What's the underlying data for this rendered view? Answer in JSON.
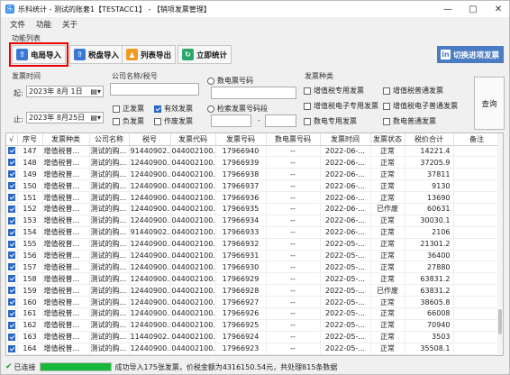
{
  "window": {
    "title": "乐科统计 - 测试的账套1【TESTACC1】 - 【销项发票管理】",
    "controls": [
      "minimize",
      "maximize",
      "close"
    ]
  },
  "menu": [
    "文件",
    "功能",
    "关于"
  ],
  "toolbar": {
    "section_label": "功能列表",
    "buttons": [
      {
        "label": "电局导入",
        "icon": "upload-icon",
        "color": "#3a78d6"
      },
      {
        "label": "税盘导入",
        "icon": "upload-icon",
        "color": "#3a78d6"
      },
      {
        "label": "列表导出",
        "icon": "export-icon",
        "color": "#f09a20"
      },
      {
        "label": "立即统计",
        "icon": "refresh-icon",
        "color": "#2aa96a"
      }
    ],
    "switch_label": "切换进项发票",
    "switch_prefix": "in"
  },
  "filters": {
    "time_label": "发票时间",
    "from_label": "起:",
    "from_date": "2023年 8月 1日",
    "to_label": "止:",
    "to_date": "2023年 8月25日",
    "company_label": "公司名称/税号",
    "checkboxes": [
      {
        "label": "正发票",
        "checked": false
      },
      {
        "label": "有效发票",
        "checked": true
      },
      {
        "label": "负发票",
        "checked": false
      },
      {
        "label": "作废发票",
        "checked": false
      }
    ],
    "radio_number": "数电票号码",
    "radio_range": "检索发票号码段",
    "range_sep": "-",
    "type_label": "发票种类",
    "types": [
      {
        "label": "增值税专用发票",
        "checked": false
      },
      {
        "label": "增值税普通发票",
        "checked": false
      },
      {
        "label": "增值税电子专用发票",
        "checked": false
      },
      {
        "label": "增值税电子普通发票",
        "checked": false
      },
      {
        "label": "数电专用发票",
        "checked": false
      },
      {
        "label": "数电普通发票",
        "checked": false
      }
    ],
    "query_label": "查询"
  },
  "table": {
    "columns": [
      "√",
      "序号",
      "发票种类",
      "公司名称",
      "税号",
      "发票代码",
      "发票号码",
      "数电票号码",
      "发票时间",
      "发票状态",
      "税价合计",
      "备注"
    ],
    "rows": [
      [
        "147",
        "增值税普...",
        "测试的购...",
        "91440902...",
        "044002100...",
        "17966940",
        "--",
        "2022-06-...",
        "正常",
        "14221.4",
        ""
      ],
      [
        "148",
        "增值税普...",
        "测试的购...",
        "12440900...",
        "044002100...",
        "17966939",
        "--",
        "2022-06-...",
        "正常",
        "37205.9",
        ""
      ],
      [
        "149",
        "增值税普...",
        "测试的购...",
        "12440900...",
        "044002100...",
        "17966938",
        "--",
        "2022-06-...",
        "正常",
        "37811",
        ""
      ],
      [
        "150",
        "增值税普...",
        "测试的购...",
        "12440900...",
        "044002100...",
        "17966937",
        "--",
        "2022-06-...",
        "正常",
        "9130",
        ""
      ],
      [
        "151",
        "增值税普...",
        "测试的购...",
        "12440900...",
        "044002100...",
        "17966936",
        "--",
        "2022-06-...",
        "正常",
        "13690",
        ""
      ],
      [
        "152",
        "增值税普...",
        "测试的购...",
        "12440900...",
        "044002100...",
        "17966935",
        "--",
        "2022-06-...",
        "已作废",
        "60631",
        ""
      ],
      [
        "153",
        "增值税普...",
        "测试的购...",
        "12440900...",
        "044002100...",
        "17966934",
        "--",
        "2022-06-...",
        "正常",
        "30030.1",
        ""
      ],
      [
        "154",
        "增值税普...",
        "测试的购...",
        "91440902...",
        "044002100...",
        "17966933",
        "--",
        "2022-06-...",
        "正常",
        "2106",
        ""
      ],
      [
        "155",
        "增值税普...",
        "测试的购...",
        "12440900...",
        "044002100...",
        "17966932",
        "--",
        "2022-05-...",
        "正常",
        "21301.2",
        ""
      ],
      [
        "156",
        "增值税普...",
        "测试的购...",
        "12440900...",
        "044002100...",
        "17966931",
        "--",
        "2022-05-...",
        "正常",
        "36400",
        ""
      ],
      [
        "157",
        "增值税普...",
        "测试的购...",
        "12440900...",
        "044002100...",
        "17966930",
        "--",
        "2022-05-...",
        "正常",
        "27880",
        ""
      ],
      [
        "158",
        "增值税普...",
        "测试的购...",
        "12440900...",
        "044002100...",
        "17966929",
        "--",
        "2022-05-...",
        "正常",
        "63831.2",
        ""
      ],
      [
        "159",
        "增值税普...",
        "测试的购...",
        "12440900...",
        "044002100...",
        "17966928",
        "--",
        "2022-05-...",
        "已作废",
        "63831.2",
        ""
      ],
      [
        "160",
        "增值税普...",
        "测试的购...",
        "12440900...",
        "044002100...",
        "17966927",
        "--",
        "2022-05-...",
        "正常",
        "38605.8",
        ""
      ],
      [
        "161",
        "增值税普...",
        "测试的购...",
        "12440900...",
        "044002100...",
        "17966926",
        "--",
        "2022-05-...",
        "正常",
        "66008",
        ""
      ],
      [
        "162",
        "增值税普...",
        "测试的购...",
        "12440900...",
        "044002100...",
        "17966925",
        "--",
        "2022-05-...",
        "正常",
        "70940",
        ""
      ],
      [
        "163",
        "增值税普...",
        "测试的购...",
        "11440902...",
        "044002100...",
        "17966924",
        "--",
        "2022-05-...",
        "正常",
        "3503",
        ""
      ],
      [
        "164",
        "增值税普...",
        "测试的购...",
        "12440900...",
        "044002100...",
        "17966923",
        "--",
        "2022-05-...",
        "正常",
        "35508.1",
        ""
      ]
    ]
  },
  "status": {
    "connected": "已连接",
    "progress_fraction": 1.0,
    "message": "成功导入175张发票，价税金额为4316150.54元，共处理815条数据"
  }
}
